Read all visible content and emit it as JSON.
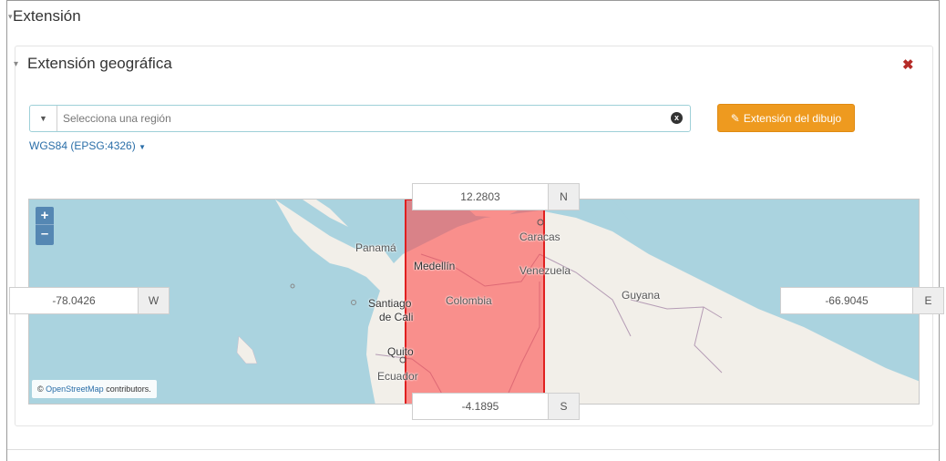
{
  "section": {
    "title": "Extensión"
  },
  "panel": {
    "title": "Extensión geográfica",
    "close_label": "✖"
  },
  "region": {
    "placeholder": "Selecciona una región",
    "clear_icon": "x"
  },
  "draw_button": {
    "label": "Extensión del dibujo",
    "icon": "pencil-icon"
  },
  "crs": {
    "label": "WGS84 (EPSG:4326)"
  },
  "map": {
    "zoom_in": "+",
    "zoom_out": "–",
    "attribution_link": "OpenStreetMap",
    "attribution_text": "contributors.",
    "attribution_prefix": "©",
    "labels": {
      "panama": "Panamá",
      "medellin": "Medellín",
      "caracas": "Caracas",
      "venezuela": "Venezuela",
      "colombia": "Colombia",
      "guyana": "Guyana",
      "santiago": "Santiago",
      "decali": "de Cali",
      "quito": "Quito",
      "ecuador": "Ecuador"
    },
    "extent_color": "#ff4040"
  },
  "bounds": {
    "north": {
      "value": "12.2803",
      "label": "N"
    },
    "south": {
      "value": "-4.1895",
      "label": "S"
    },
    "west": {
      "value": "-78.0426",
      "label": "W"
    },
    "east": {
      "value": "-66.9045",
      "label": "E"
    }
  }
}
